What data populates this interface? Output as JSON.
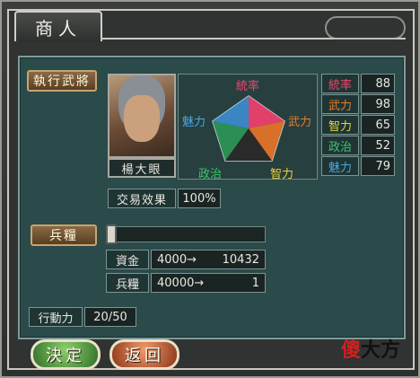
{
  "window": {
    "title": "商人"
  },
  "general": {
    "button_label": "執行武將",
    "name": "楊大眼"
  },
  "radar": {
    "labels": {
      "leadership": "統率",
      "war": "武力",
      "intel": "智力",
      "politics": "政治",
      "charm": "魅力"
    },
    "colors": {
      "leadership": "#f0466e",
      "war": "#e87b2a",
      "intel": "#e6d23a",
      "politics": "#39c86a",
      "charm": "#47a8e6"
    }
  },
  "stats": [
    {
      "name": "統率",
      "value": "88",
      "color": "#f0466e"
    },
    {
      "name": "武力",
      "value": "98",
      "color": "#e87b2a"
    },
    {
      "name": "智力",
      "value": "65",
      "color": "#e6d23a"
    },
    {
      "name": "政治",
      "value": "52",
      "color": "#39c86a"
    },
    {
      "name": "魅力",
      "value": "79",
      "color": "#47a8e6"
    }
  ],
  "trade": {
    "label": "交易效果",
    "value": "100%"
  },
  "food_slider": {
    "label": "兵糧",
    "level": 0.0
  },
  "funds": {
    "label": "資金",
    "from": "4000→",
    "to": "10432"
  },
  "provisions": {
    "label": "兵糧",
    "from": "40000→",
    "to": "1"
  },
  "action": {
    "label": "行動力",
    "value": "20/50"
  },
  "buttons": {
    "ok": "決定",
    "back": "返回"
  },
  "watermark": {
    "part1": "傻",
    "part2": "大方"
  }
}
